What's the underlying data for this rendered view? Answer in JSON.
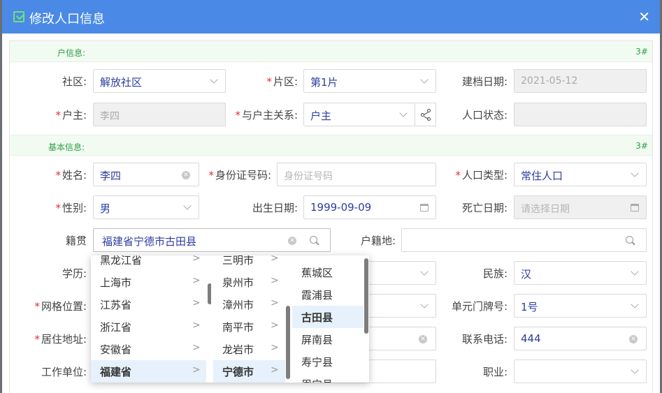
{
  "title": "修改人口信息",
  "close_icon": "✕",
  "section_household": {
    "label": "户信息:",
    "right": "3#"
  },
  "section_basic": {
    "label": "基本信息:",
    "right": "3#"
  },
  "fields": {
    "community": {
      "label": "社区:",
      "value": "解放社区"
    },
    "area": {
      "label": "片区:",
      "value": "第1片"
    },
    "file_date": {
      "label": "建档日期:",
      "value": "2021-05-12"
    },
    "householder": {
      "label": "户主:",
      "value": "李四"
    },
    "relation": {
      "label": "与户主关系:",
      "value": "户主"
    },
    "status": {
      "label": "人口状态:",
      "value": ""
    },
    "name": {
      "label": "姓名:",
      "value": "李四"
    },
    "idcard": {
      "label": "身份证号码:",
      "placeholder": "身份证号码"
    },
    "pop_type": {
      "label": "人口类型:",
      "value": "常住人口"
    },
    "gender": {
      "label": "性别:",
      "value": "男"
    },
    "birth": {
      "label": "出生日期:",
      "value": "1999-09-09"
    },
    "death": {
      "label": "死亡日期:",
      "placeholder": "请选择日期"
    },
    "native": {
      "label": "籍贯",
      "value": "福建省宁德市古田县"
    },
    "hukou": {
      "label": "户籍地:",
      "value": ""
    },
    "education": {
      "label": "学历:"
    },
    "ethnicity": {
      "label": "民族:",
      "value": "汉"
    },
    "grid": {
      "label": "网格位置:"
    },
    "unit": {
      "label": "单元门牌号:",
      "value": "1号"
    },
    "address": {
      "label": "居住地址:"
    },
    "phone": {
      "label": "联系电话:",
      "value": "444"
    },
    "work": {
      "label": "工作单位:"
    },
    "job": {
      "label": "职业:",
      "value": ""
    }
  },
  "cascader": {
    "provinces": [
      "黑龙江省",
      "上海市",
      "江苏省",
      "浙江省",
      "安徽省",
      "福建省"
    ],
    "cities": [
      "三明市",
      "泉州市",
      "漳州市",
      "南平市",
      "龙岩市",
      "宁德市"
    ],
    "counties": [
      "蕉城区",
      "霞浦县",
      "古田县",
      "屏南县",
      "寿宁县",
      "周宁县"
    ],
    "arrow": ">"
  }
}
